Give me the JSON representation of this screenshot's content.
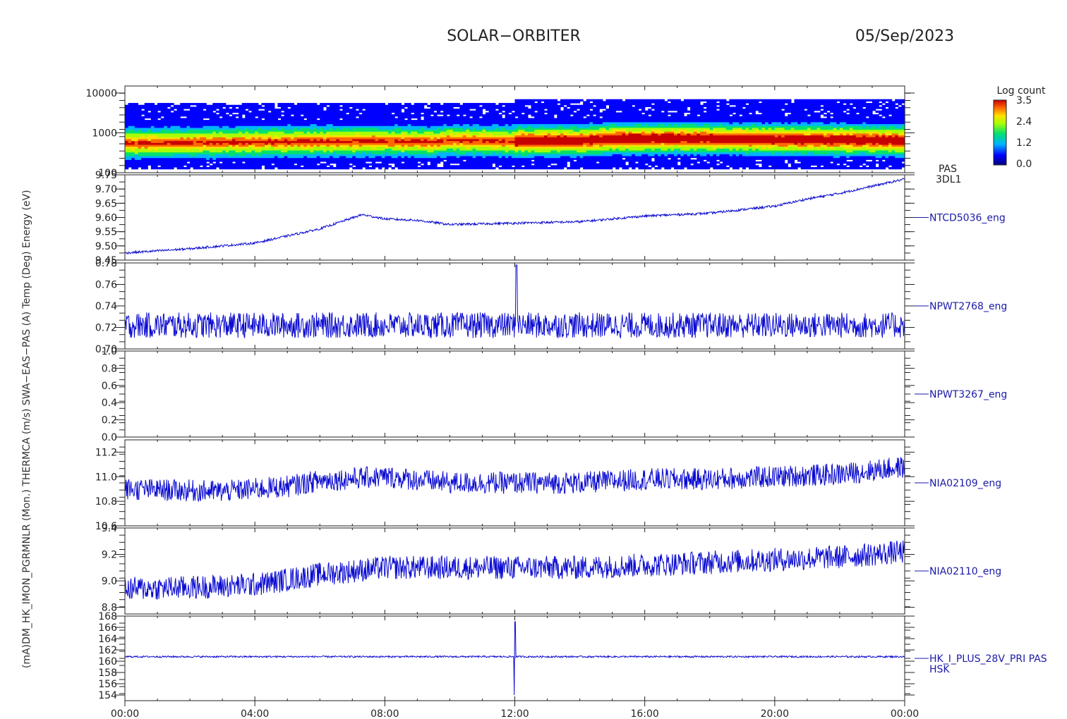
{
  "header": {
    "mission": "SOLAR−ORBITER",
    "date": "05/Sep/2023"
  },
  "colorbar": {
    "title": "Log count",
    "ticks": [
      "3.5",
      "2.4",
      "1.2",
      "0.0"
    ],
    "vmin": 0.0,
    "vmax": 3.5
  },
  "pas_labels": [
    "PAS",
    "3DL1"
  ],
  "y_axis_label": "(mA)DM_HK_IMON_PGRMNLR (Mon.) THERMCA (m/s) SWA−EAS−PAS (A) Temp (Deg) Energy (eV)",
  "x_ticks": [
    "00:00",
    "04:00",
    "08:00",
    "12:00",
    "16:00",
    "20:00",
    "00:00"
  ],
  "chart_data": [
    {
      "type": "heatmap",
      "name": "",
      "ylabel": "(eV)",
      "yscale": "log",
      "ylim": [
        100,
        15000
      ],
      "yticks": [
        "10000",
        "1000",
        "100"
      ],
      "ytick_values": [
        10000,
        1000,
        100
      ],
      "x_hours": [
        0,
        2,
        4,
        6,
        8,
        9.4,
        10,
        12,
        12.1,
        14,
        15,
        16,
        17,
        18,
        20,
        22,
        24
      ],
      "peak_energy_eV": [
        560,
        580,
        600,
        620,
        640,
        600,
        660,
        620,
        640,
        650,
        720,
        730,
        740,
        720,
        700,
        680,
        650
      ],
      "band_colors": {
        "low": "#0000aa",
        "mid": "#00dd55",
        "high": "#e03000"
      }
    },
    {
      "type": "line",
      "name": "NTCD5036_eng",
      "ylim": [
        9.45,
        9.75
      ],
      "yticks": [
        "9.75",
        "9.70",
        "9.65",
        "9.60",
        "9.55",
        "9.50",
        "9.45"
      ],
      "ytick_values": [
        9.75,
        9.7,
        9.65,
        9.6,
        9.55,
        9.5,
        9.45
      ],
      "x_hours": [
        0,
        2,
        4,
        6,
        7.3,
        8,
        9,
        10,
        12,
        14,
        16,
        18,
        20,
        21,
        22,
        23,
        24
      ],
      "y": [
        9.475,
        9.49,
        9.51,
        9.56,
        9.61,
        9.595,
        9.59,
        9.575,
        9.58,
        9.585,
        9.605,
        9.615,
        9.64,
        9.665,
        9.685,
        9.71,
        9.735
      ],
      "noise": 0.004
    },
    {
      "type": "line",
      "name": "NPWT2768_eng",
      "ylim": [
        0.7,
        0.78
      ],
      "yticks": [
        "0.78",
        "0.76",
        "0.74",
        "0.72",
        "0.70"
      ],
      "ytick_values": [
        0.78,
        0.76,
        0.74,
        0.72,
        0.7
      ],
      "x_hours": [
        0,
        24
      ],
      "y": [
        0.722,
        0.722
      ],
      "noise": 0.012,
      "spike_hour": 12.05,
      "spike_value": 0.778
    },
    {
      "type": "line",
      "name": "NPWT3267_eng",
      "ylim": [
        0.0,
        1.0
      ],
      "yticks": [
        "1.0",
        "0.8",
        "0.6",
        "0.4",
        "0.2",
        "0.0"
      ],
      "ytick_values": [
        1.0,
        0.8,
        0.6,
        0.4,
        0.2,
        0.0
      ],
      "x_hours": [
        0,
        24
      ],
      "y": [
        0.0,
        0.0
      ],
      "noise": 0.0
    },
    {
      "type": "line",
      "name": "NIA02109_eng",
      "ylim": [
        10.6,
        11.3
      ],
      "yticks": [
        "11.2",
        "11.0",
        "10.8",
        "10.6"
      ],
      "ytick_values": [
        11.2,
        11.0,
        10.8,
        10.6
      ],
      "x_hours": [
        0,
        3,
        5,
        6,
        8,
        10,
        12,
        14,
        16,
        18,
        20,
        22,
        24
      ],
      "y": [
        10.9,
        10.88,
        10.92,
        10.97,
        11.0,
        10.95,
        10.95,
        10.95,
        10.98,
        10.98,
        11.0,
        11.02,
        11.08
      ],
      "noise": 0.09
    },
    {
      "type": "line",
      "name": "NIA02110_eng",
      "ylim": [
        8.75,
        9.4
      ],
      "yticks": [
        "9.4",
        "9.2",
        "9.0",
        "8.8"
      ],
      "ytick_values": [
        9.4,
        9.2,
        9.0,
        8.8
      ],
      "x_hours": [
        0,
        2,
        4,
        6,
        8,
        10,
        12,
        14,
        16,
        18,
        20,
        22,
        24
      ],
      "y": [
        8.94,
        8.95,
        8.97,
        9.05,
        9.1,
        9.1,
        9.1,
        9.1,
        9.12,
        9.14,
        9.16,
        9.18,
        9.22
      ],
      "noise": 0.09
    },
    {
      "type": "line",
      "name": "HK_I_PLUS_28V_PRI PAS",
      "name2": "HSK",
      "ylim": [
        153,
        168
      ],
      "yticks": [
        "168",
        "166",
        "164",
        "162",
        "160",
        "158",
        "156",
        "154"
      ],
      "ytick_values": [
        168,
        166,
        164,
        162,
        160,
        158,
        156,
        154
      ],
      "x_hours": [
        0,
        24
      ],
      "y": [
        160.8,
        160.8
      ],
      "noise": 0.15,
      "spike_hour": 12.0,
      "spike_low": 154.0,
      "spike_high": 167.0
    }
  ]
}
